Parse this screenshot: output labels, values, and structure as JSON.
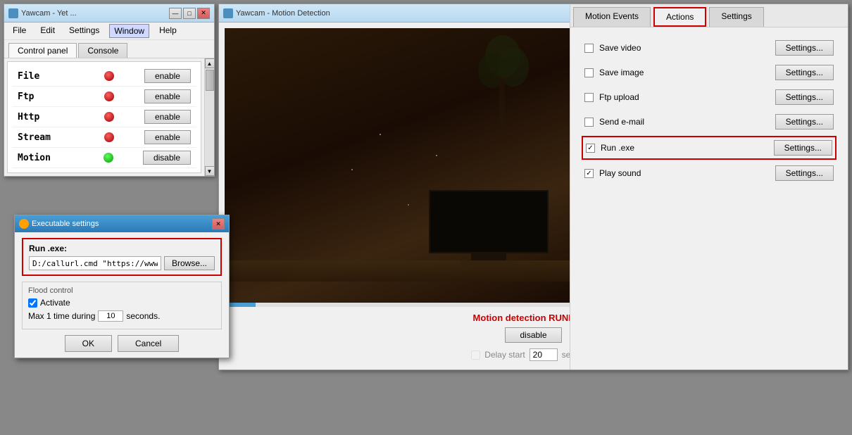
{
  "win1": {
    "title": "Yawcam - Yet ...",
    "tabs": [
      "Control panel",
      "Console"
    ],
    "active_tab": "Control panel",
    "menu": [
      "File",
      "Edit",
      "Settings",
      "Window",
      "Help"
    ],
    "active_menu": "Window",
    "services": [
      {
        "name": "File",
        "status": "red",
        "btn": "enable"
      },
      {
        "name": "Ftp",
        "status": "red",
        "btn": "enable"
      },
      {
        "name": "Http",
        "status": "red",
        "btn": "enable"
      },
      {
        "name": "Stream",
        "status": "red",
        "btn": "enable"
      },
      {
        "name": "Motion",
        "status": "green",
        "btn": "disable"
      }
    ]
  },
  "win2": {
    "title": "Yawcam - Motion Detection",
    "motion_status": "Motion detection RUNNING.",
    "disable_btn": "disable",
    "delay_label": "Delay start",
    "delay_value": "20",
    "seconds_label": "seconds."
  },
  "right_panel": {
    "tabs": [
      {
        "id": "motion-events",
        "label": "Motion Events"
      },
      {
        "id": "actions",
        "label": "Actions"
      },
      {
        "id": "settings-tab",
        "label": "Settings"
      }
    ],
    "active_tab": "actions",
    "actions": [
      {
        "id": "save-video",
        "label": "Save video",
        "checked": false,
        "settings_btn": "Settings..."
      },
      {
        "id": "save-image",
        "label": "Save image",
        "checked": false,
        "settings_btn": "Settings..."
      },
      {
        "id": "ftp-upload",
        "label": "Ftp upload",
        "checked": false,
        "settings_btn": "Settings..."
      },
      {
        "id": "send-email",
        "label": "Send e-mail",
        "checked": false,
        "settings_btn": "Settings..."
      },
      {
        "id": "run-exe",
        "label": "Run .exe",
        "checked": true,
        "settings_btn": "Settings...",
        "highlighted": true
      },
      {
        "id": "play-sound",
        "label": "Play sound",
        "checked": true,
        "settings_btn": "Settings..."
      }
    ]
  },
  "exe_settings": {
    "title": "Executable settings",
    "run_exe_label": "Run .exe:",
    "run_exe_value": "D:/callurl.cmd \"https://www.pus",
    "browse_btn": "Browse...",
    "flood_label": "Flood control",
    "activate_label": "Activate",
    "activate_checked": true,
    "max_label": "Max 1 time during",
    "max_value": "10",
    "max_suffix": "seconds.",
    "ok_btn": "OK",
    "cancel_btn": "Cancel"
  }
}
